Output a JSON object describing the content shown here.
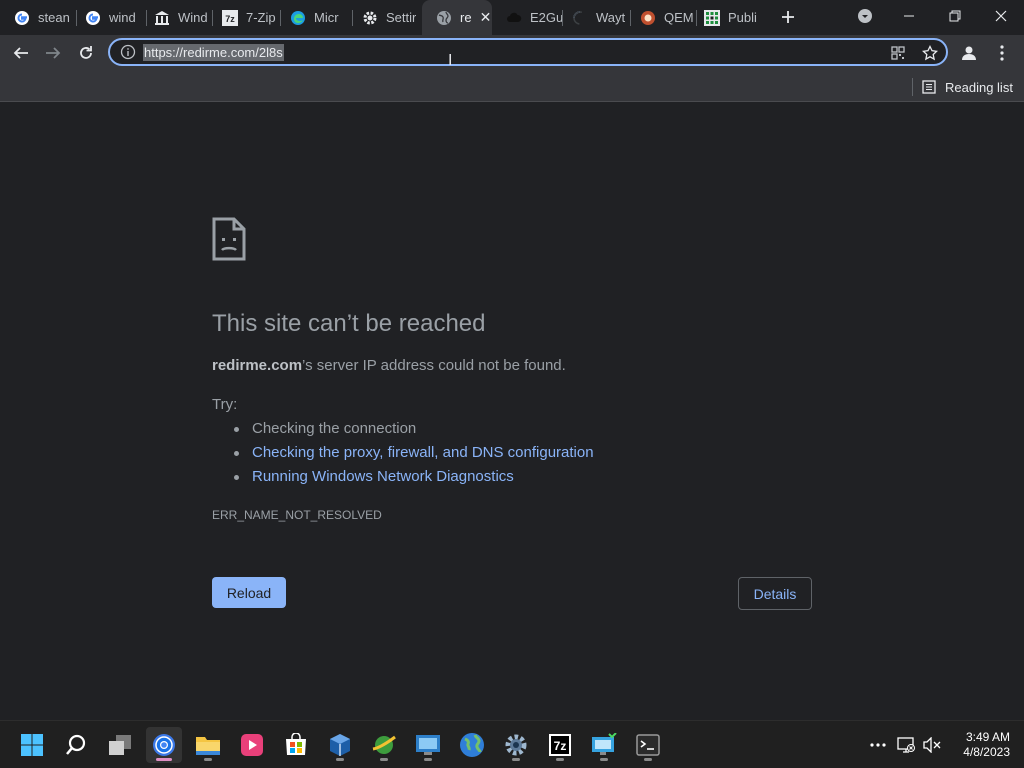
{
  "tabs": [
    {
      "label": "stean",
      "icon": "google-icon"
    },
    {
      "label": "wind",
      "icon": "google-icon"
    },
    {
      "label": "Wind",
      "icon": "bank-icon"
    },
    {
      "label": "7-Zip",
      "icon": "7zip-icon"
    },
    {
      "label": "Micr",
      "icon": "edge-icon"
    },
    {
      "label": "Settir",
      "icon": "gear-icon"
    },
    {
      "label": "re",
      "icon": "globe-icon",
      "active": true
    },
    {
      "label": "E2Gu",
      "icon": "cloud-icon"
    },
    {
      "label": "Wayt",
      "icon": "loading-spinner-icon"
    },
    {
      "label": "QEM",
      "icon": "qemu-icon"
    },
    {
      "label": "Publi",
      "icon": "grid-icon"
    }
  ],
  "omnibox": {
    "url": "https://redirme.com/2l8s"
  },
  "bookmarks": {
    "reading_list": "Reading list"
  },
  "error": {
    "title": "This site can’t be reached",
    "domain": "redirme.com",
    "desc_suffix": "’s server IP address could not be found.",
    "try_label": "Try:",
    "tips": [
      "Checking the connection",
      "Checking the proxy, firewall, and DNS configuration",
      "Running Windows Network Diagnostics"
    ],
    "code": "ERR_NAME_NOT_RESOLVED",
    "reload_label": "Reload",
    "details_label": "Details"
  },
  "taskbar": {
    "apps": [
      "windows-start-icon",
      "search-icon",
      "task-view-icon",
      "chrome-icon",
      "file-explorer-icon",
      "media-player-icon",
      "microsoft-store-icon",
      "virtualbox-icon",
      "network-tool-icon",
      "remote-desktop-icon",
      "globe-icon",
      "settings-gear-icon",
      "7zip-icon",
      "network-monitor-icon",
      "terminal-icon"
    ],
    "time": "3:49 AM",
    "date": "4/8/2023"
  },
  "colors": {
    "accent": "#8ab4f8",
    "background": "#202124",
    "toolbar": "#35363a"
  }
}
